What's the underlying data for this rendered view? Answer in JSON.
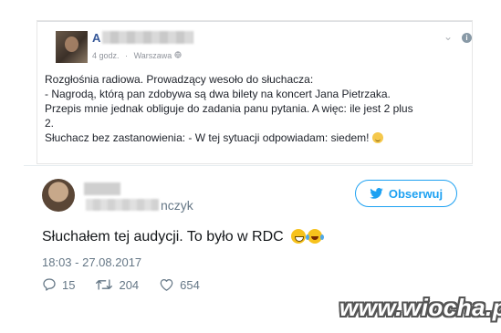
{
  "fb_post": {
    "author_initial": "A",
    "time": "4 godz.",
    "separator": "·",
    "location": "Warszawa",
    "location_icon": "globe-icon",
    "lines": [
      "Rozgłośnia radiowa. Prowadzący wesoło do słuchacza:",
      "- Nagrodą, którą pan zdobywa są dwa bilety na koncert Jana Pietrzaka.",
      "Przepis mnie jednak obliguje do zadania panu pytania. A więc: ile jest 2 plus",
      "2.",
      "Słuchacz bez zastanowienia: - W tej sytuacji odpowiadam: siedem!"
    ]
  },
  "tweet": {
    "handle_suffix": "nczyk",
    "follow_label": "Obserwuj",
    "text": "Słuchałem tej audycji. To było w RDC",
    "timestamp": "18:03 - 27.08.2017",
    "replies": "15",
    "retweets": "204",
    "likes": "654"
  },
  "colors": {
    "accent": "#1da1f2",
    "fb_link": "#365899",
    "muted": "#657786"
  },
  "watermark": "www.wiocha.pl"
}
